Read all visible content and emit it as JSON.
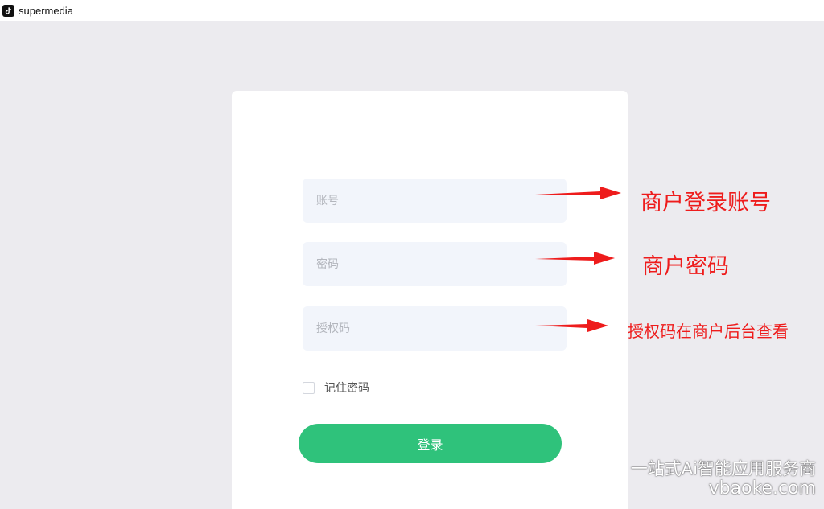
{
  "window": {
    "app_title": "supermedia",
    "icon": "tiktok-icon"
  },
  "login_form": {
    "account_placeholder": "账号",
    "password_placeholder": "密码",
    "auth_code_placeholder": "授权码",
    "remember_label": "记住密码",
    "remember_checked": false,
    "login_label": "登录"
  },
  "annotations": {
    "account_note": "商户登录账号",
    "password_note": "商户密码",
    "auth_code_note": "授权码在商户后台查看",
    "arrow_color": "#ee1c1c"
  },
  "watermark": {
    "line1": "一站式Ai智能应用服务商",
    "line2": "vbaoke.com"
  },
  "colors": {
    "primary_button": "#2fc27b",
    "background": "#ecebef",
    "field_bg": "#f2f5fb"
  }
}
